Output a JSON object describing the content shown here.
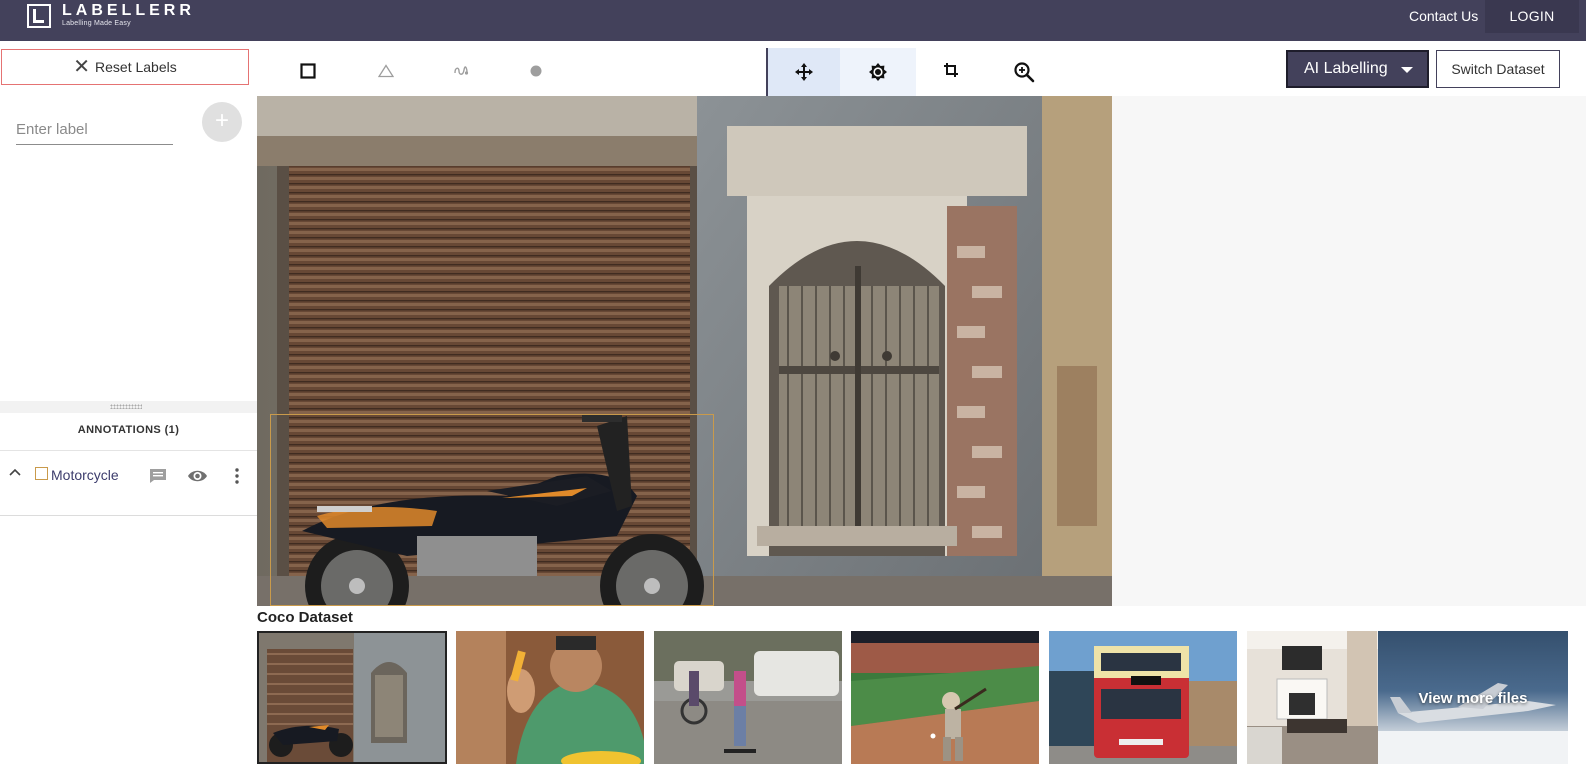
{
  "header": {
    "brand": "LABELLERR",
    "tagline": "Labelling Made Easy",
    "contact_label": "Contact Us",
    "login_label": "LOGIN"
  },
  "left_panel": {
    "reset_label": "Reset Labels",
    "label_input": {
      "placeholder": "Enter label",
      "value": ""
    },
    "add_icon": "plus-icon",
    "annotations_header": "ANNOTATIONS (1)",
    "annotations": [
      {
        "label": "Motorcycle",
        "color": "#c99a4b",
        "visible": true
      }
    ]
  },
  "toolbar": {
    "tools": [
      {
        "name": "bounding-box",
        "icon": "square-icon"
      },
      {
        "name": "polygon",
        "icon": "triangle-icon"
      },
      {
        "name": "freehand",
        "icon": "freehand-icon"
      },
      {
        "name": "point",
        "icon": "dot-icon"
      },
      {
        "name": "move",
        "icon": "move-icon",
        "active": true
      },
      {
        "name": "brightness",
        "icon": "brightness-icon"
      },
      {
        "name": "crop",
        "icon": "crop-icon"
      },
      {
        "name": "zoom",
        "icon": "zoom-in-icon"
      }
    ],
    "ai_label": "AI Labelling",
    "switch_label": "Switch Dataset"
  },
  "dataset": {
    "title": "Coco Dataset",
    "thumbnails": [
      "storefront-motorcycle",
      "man-eating",
      "street-skateboard",
      "baseball-batter",
      "double-decker-bus",
      "living-room"
    ],
    "view_more_label": "View more files"
  },
  "colors": {
    "nav": "#43415b",
    "accent_box": "#c99a4b",
    "reset_border": "#e57373",
    "active_tool_bg": "#dfe8f7"
  }
}
